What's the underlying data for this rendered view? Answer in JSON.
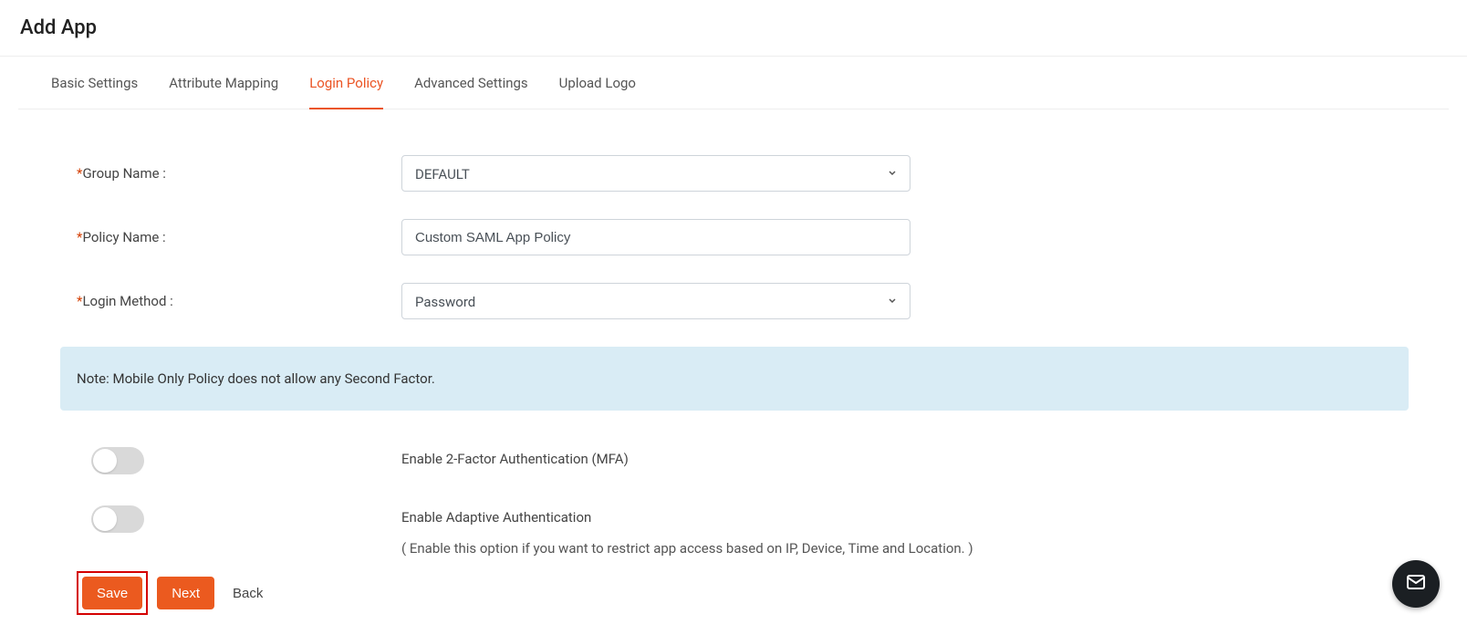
{
  "page": {
    "title": "Add App"
  },
  "tabs": [
    {
      "label": "Basic Settings"
    },
    {
      "label": "Attribute Mapping"
    },
    {
      "label": "Login Policy"
    },
    {
      "label": "Advanced Settings"
    },
    {
      "label": "Upload Logo"
    }
  ],
  "form": {
    "group_name_label": "Group Name :",
    "group_name_value": "DEFAULT",
    "policy_name_label": "Policy Name :",
    "policy_name_value": "Custom SAML App Policy",
    "login_method_label": "Login Method :",
    "login_method_value": "Password"
  },
  "note": {
    "text": "Note: Mobile Only Policy does not allow any Second Factor."
  },
  "toggles": {
    "mfa_label": "Enable 2-Factor Authentication (MFA)",
    "adaptive_label": "Enable Adaptive Authentication",
    "adaptive_sub": "( Enable this option if you want to restrict app access based on IP, Device, Time and Location. )"
  },
  "actions": {
    "save": "Save",
    "next": "Next",
    "back": "Back"
  }
}
